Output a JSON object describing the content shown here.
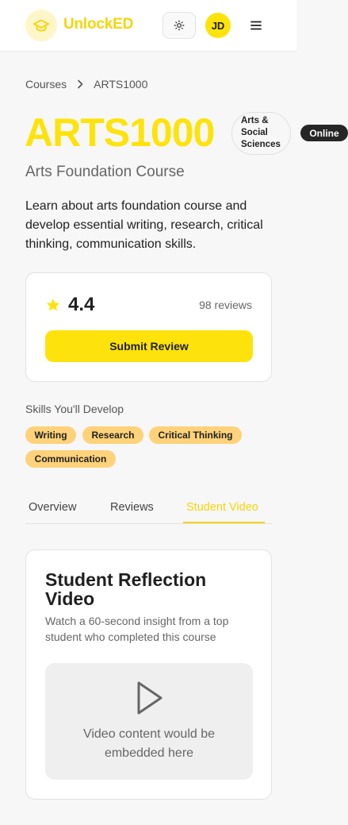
{
  "header": {
    "logo_text": "UnlockED",
    "avatar_initials": "JD"
  },
  "breadcrumb": {
    "items": [
      "Courses",
      "ARTS1000"
    ]
  },
  "course": {
    "code": "ARTS1000",
    "faculty": [
      "Arts &",
      "Social",
      "Sciences"
    ],
    "delivery": "Online",
    "title": "Arts Foundation Course",
    "description": "Learn about arts foundation course and develop essential writing, research, critical thinking, communication skills."
  },
  "rating": {
    "value": "4.4",
    "reviews": "98 reviews",
    "submit_label": "Submit Review"
  },
  "skills": {
    "heading": "Skills You'll Develop",
    "items": [
      "Writing",
      "Research",
      "Critical Thinking",
      "Communication"
    ]
  },
  "tabs": {
    "items": [
      "Overview",
      "Reviews",
      "Student Video"
    ],
    "active": "Student Video"
  },
  "video": {
    "title": "Student Reflection Video",
    "subtitle": "Watch a 60-second insight from a top student who completed this course",
    "placeholder_line1": "Video content would be",
    "placeholder_line2": "embedded here"
  },
  "colors": {
    "accent": "#fde30b",
    "skill_tag": "#fdd27a",
    "dark_badge": "#262626"
  },
  "icons": [
    "graduation-cap-icon",
    "sun-icon",
    "hamburger-menu-icon",
    "chevron-right-icon",
    "star-icon",
    "play-icon"
  ]
}
